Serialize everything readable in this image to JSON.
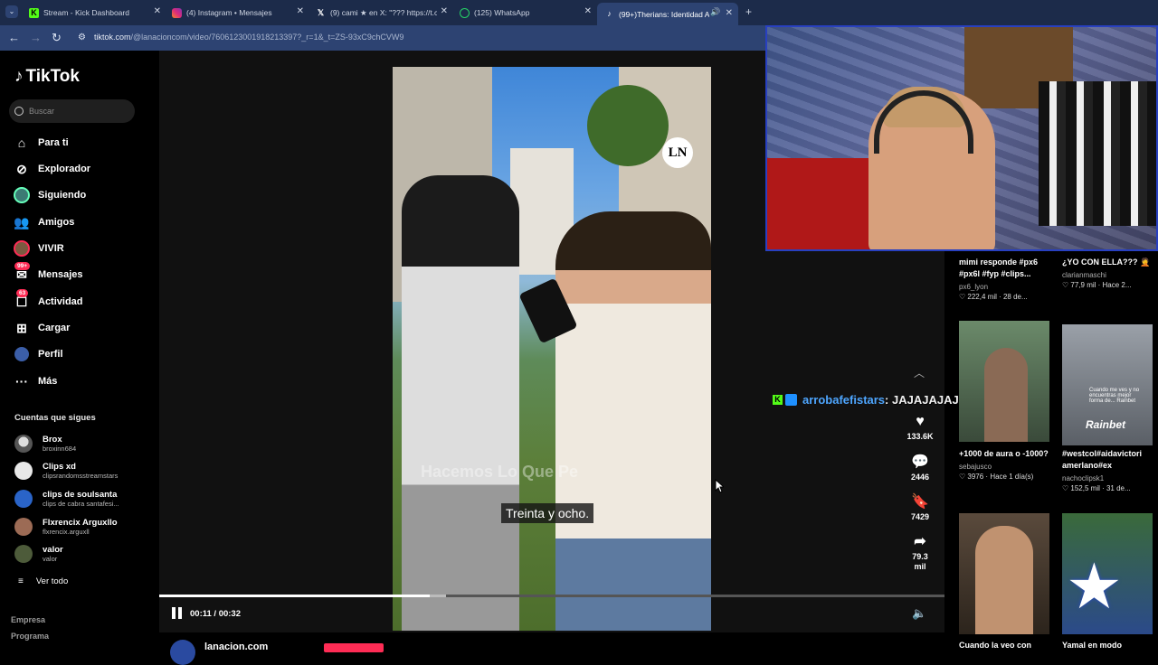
{
  "browser": {
    "tabs": [
      {
        "title": "Stream - Kick Dashboard",
        "icon": "kick-icon",
        "color": "#53fc18"
      },
      {
        "title": "(4) Instagram • Mensajes",
        "icon": "instagram-icon",
        "color": "#e1306c"
      },
      {
        "title": "(9) cami ★ en X: \"??? https://t.c",
        "icon": "x-icon",
        "color": "#ffffff"
      },
      {
        "title": "(125) WhatsApp",
        "icon": "whatsapp-icon",
        "color": "#25d366"
      },
      {
        "title": "(99+)Therians: Identidad A",
        "icon": "tiktok-icon",
        "color": "#ffffff"
      }
    ],
    "new_tab": "+",
    "url_host": "tiktok.com",
    "url_path": "/@lanacioncom/video/7606123001918213397?_r=1&_t=ZS-93xC9chCVW9"
  },
  "sidebar": {
    "logo": "TikTok",
    "search_placeholder": "Buscar",
    "nav": [
      {
        "label": "Para ti",
        "icon": "home-icon"
      },
      {
        "label": "Explorador",
        "icon": "compass-icon"
      },
      {
        "label": "Siguiendo",
        "icon": "following-icon"
      },
      {
        "label": "Amigos",
        "icon": "friends-icon"
      },
      {
        "label": "VIVIR",
        "icon": "live-icon"
      },
      {
        "label": "Mensajes",
        "icon": "messages-icon",
        "badge": "99+"
      },
      {
        "label": "Actividad",
        "icon": "activity-icon",
        "badge": "63"
      },
      {
        "label": "Cargar",
        "icon": "upload-icon"
      },
      {
        "label": "Perfil",
        "icon": "profile-icon"
      },
      {
        "label": "Más",
        "icon": "more-icon"
      }
    ],
    "follows_title": "Cuentas que sigues",
    "follows": [
      {
        "name": "Brox",
        "handle": "broxinn684",
        "color": "#d9d9d9"
      },
      {
        "name": "Clips xd",
        "handle": "clipsrandomsstreamstars",
        "color": "#e8e8e8"
      },
      {
        "name": "clips de soulsanta",
        "handle": "clips de cabra santafesi...",
        "color": "#2a64c8"
      },
      {
        "name": "Flxrencix Arguxllo",
        "handle": "flxrencix.arguxll",
        "color": "#9c6b55"
      },
      {
        "name": "valor",
        "handle": "valor",
        "color": "#4d5b3a"
      }
    ],
    "see_all": "Ver todo",
    "footer": [
      "Empresa",
      "Programa"
    ]
  },
  "video": {
    "watermark": "Hacemos Lo Que Pe",
    "subtitle": "Treinta y ocho.",
    "channel_logo": "LN",
    "time": "00:11 / 00:32",
    "progress": 0.344,
    "author": "lanacion.com"
  },
  "actions": {
    "likes": "133.6K",
    "comments": "2446",
    "saves": "7429",
    "shares_line1": "79.3",
    "shares_line2": "mil"
  },
  "chat": {
    "user": "arrobafefistars",
    "separator": ": ",
    "message": "JAJAJAJAJAJA"
  },
  "feed": [
    {
      "title": "mimi responde #px6 #px6l #fyp #clips...",
      "author": "px6_lyon",
      "stats": "222,4 mil",
      "date": "28 de...",
      "thumb_color": "#2a2f3a"
    },
    {
      "title": "¿YO CON ELLA??? 🤦",
      "author": "clarianmaschi",
      "stats": "77,9 mil",
      "date": "Hace 2...",
      "thumb_color": "#2a2f3a"
    },
    {
      "title": "+1000 de aura o -1000?",
      "author": "sebajusco",
      "stats": "3976",
      "date": "Hace 1 día(s)",
      "thumb_color": "#5b7a55"
    },
    {
      "title": "#westcol#aidavictori amerlano#ex",
      "author": "nachoclipsk1",
      "stats": "152,5 mil",
      "date": "31 de...",
      "thumb_color": "#8a8f95",
      "caption": "Cuando me ves y no encuentras mejor forma de... Rainbet",
      "brand": "Rainbet"
    },
    {
      "title": "Cuando la veo con",
      "author": "",
      "stats": "",
      "date": "",
      "thumb_color": "#4a3f35"
    },
    {
      "title": "Yamal en modo",
      "author": "",
      "stats": "",
      "date": "",
      "thumb_color": "#2b4a8a"
    }
  ]
}
